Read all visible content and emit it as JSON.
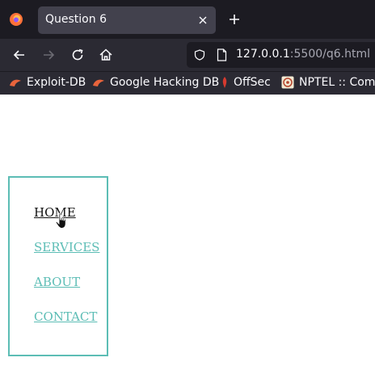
{
  "browser": {
    "tab": {
      "title": "Question 6",
      "close_icon": "close-icon"
    },
    "new_tab_icon": "plus-icon",
    "nav": {
      "back_icon": "back-arrow-icon",
      "forward_icon": "forward-arrow-icon",
      "reload_icon": "reload-icon",
      "home_icon": "home-icon"
    },
    "url": {
      "host": "127.0.0.1",
      "rest": ":5500/q6.html"
    },
    "bookmarks": [
      {
        "label": "Exploit-DB",
        "icon": "exploit-db-icon"
      },
      {
        "label": "Google Hacking DB",
        "icon": "ghdb-icon"
      },
      {
        "label": "OffSec",
        "icon": "offsec-icon"
      },
      {
        "label": "NPTEL :: Comp",
        "icon": "nptel-icon"
      }
    ]
  },
  "page": {
    "nav_items": [
      {
        "label": "HOME",
        "active": true
      },
      {
        "label": "SERVICES",
        "active": false
      },
      {
        "label": "ABOUT",
        "active": false
      },
      {
        "label": "CONTACT",
        "active": false
      }
    ]
  },
  "colors": {
    "accent": "#5cbdb5",
    "active_link": "#111111",
    "chrome_dark": "#1c1b22",
    "chrome": "#2b2a33",
    "tab_active": "#42414d"
  }
}
